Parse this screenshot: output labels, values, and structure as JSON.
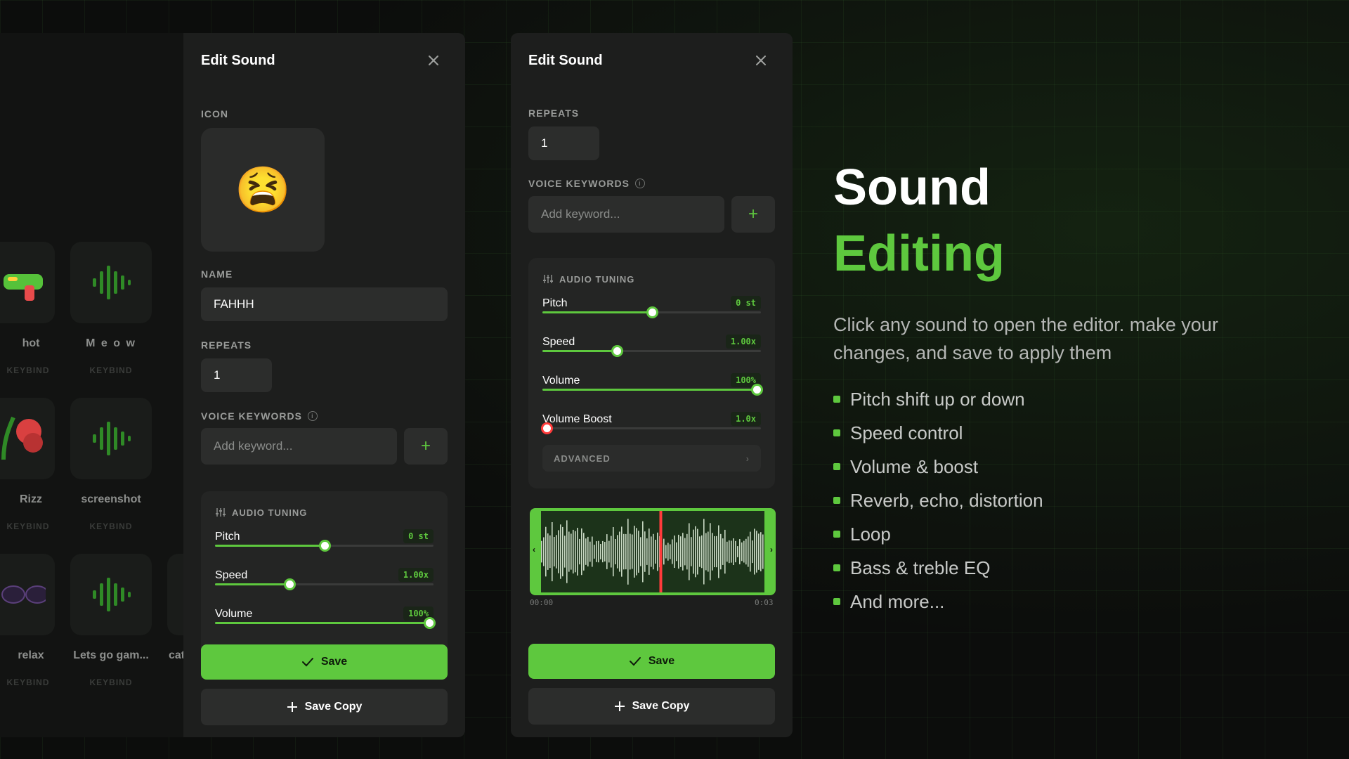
{
  "background_grid": {
    "cards": [
      {
        "name": "hot",
        "keybind": "KEYBIND"
      },
      {
        "name": "M e o w",
        "keybind": "KEYBIND"
      },
      {
        "name": "Rizz",
        "keybind": "KEYBIND"
      },
      {
        "name": "screenshot",
        "keybind": "KEYBIND"
      },
      {
        "name": "relax",
        "keybind": "KEYBIND"
      },
      {
        "name": "Lets go gam...",
        "keybind": "KEYBIND"
      },
      {
        "name": "cat",
        "keybind": ""
      }
    ]
  },
  "left_modal": {
    "title": "Edit Sound",
    "icon_label": "ICON",
    "icon_emoji": "😫",
    "name_label": "NAME",
    "name_value": "FAHHH",
    "repeats_label": "REPEATS",
    "repeats_value": "1",
    "keywords_label": "VOICE KEYWORDS",
    "keywords_placeholder": "Add keyword...",
    "add_symbol": "+",
    "tuning_title": "AUDIO TUNING",
    "sliders": [
      {
        "name": "Pitch",
        "value": "0 st",
        "fraction": 0.5
      },
      {
        "name": "Speed",
        "value": "1.00x",
        "fraction": 0.34
      },
      {
        "name": "Volume",
        "value": "100%",
        "fraction": 0.98
      }
    ],
    "save_label": "Save",
    "save_copy_label": "Save Copy"
  },
  "right_modal": {
    "title": "Edit Sound",
    "repeats_label": "REPEATS",
    "repeats_value": "1",
    "keywords_label": "VOICE KEYWORDS",
    "keywords_placeholder": "Add keyword...",
    "add_symbol": "+",
    "tuning_title": "AUDIO TUNING",
    "sliders": [
      {
        "name": "Pitch",
        "value": "0 st",
        "fraction": 0.5
      },
      {
        "name": "Speed",
        "value": "1.00x",
        "fraction": 0.34
      },
      {
        "name": "Volume",
        "value": "100%",
        "fraction": 0.98
      },
      {
        "name": "Volume Boost",
        "value": "1.0x",
        "fraction": 0.02
      }
    ],
    "advanced_label": "ADVANCED",
    "time_start": "00:00",
    "time_end": "0:03",
    "playhead_fraction": 0.53,
    "save_label": "Save",
    "save_copy_label": "Save Copy"
  },
  "hero": {
    "title_line1": "Sound",
    "title_line2": "Editing",
    "description": "Click any sound to open the editor. make your changes, and save to apply them",
    "features": [
      "Pitch shift up or down",
      "Speed control",
      "Volume & boost",
      "Reverb, echo, distortion",
      "Loop",
      "Bass & treble EQ",
      "And more..."
    ]
  },
  "colors": {
    "accent": "#5ec83e",
    "panel": "#1d1e1d",
    "background": "#0c0d0c",
    "playhead": "#ff3b3b"
  }
}
